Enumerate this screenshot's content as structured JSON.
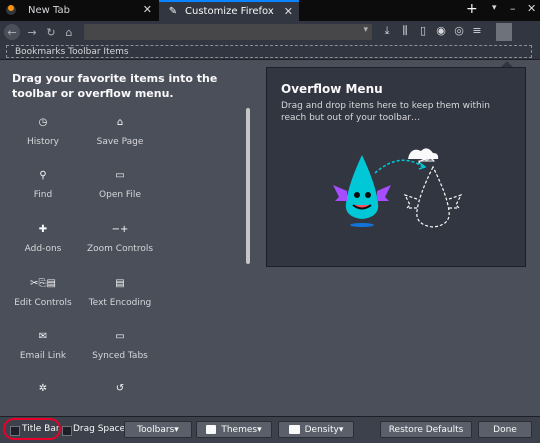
{
  "tabs": [
    {
      "label": "New Tab"
    },
    {
      "label": "Customize Firefox"
    }
  ],
  "bookmarks_toolbar": {
    "label": "Bookmarks Toolbar Items"
  },
  "palette": {
    "title": "Drag your favorite items into the toolbar or overflow menu.",
    "items": [
      {
        "label": "History",
        "icon": "clock-icon",
        "glyph": "◷"
      },
      {
        "label": "Save Page",
        "icon": "folder-icon",
        "glyph": "⌂"
      },
      {
        "label": "Find",
        "icon": "search-icon",
        "glyph": "⚲"
      },
      {
        "label": "Open File",
        "icon": "open-file-icon",
        "glyph": "▭"
      },
      {
        "label": "Add-ons",
        "icon": "puzzle-icon",
        "glyph": "✚"
      },
      {
        "label": "Zoom Controls",
        "icon": "zoom-icon",
        "glyph": "−+"
      },
      {
        "label": "Edit Controls",
        "icon": "scissors-icon",
        "glyph": "✂⎘▤"
      },
      {
        "label": "Text Encoding",
        "icon": "text-encoding-icon",
        "glyph": "▤"
      },
      {
        "label": "Email Link",
        "icon": "envelope-icon",
        "glyph": "✉"
      },
      {
        "label": "Synced Tabs",
        "icon": "laptop-icon",
        "glyph": "▭"
      },
      {
        "label": "",
        "icon": "gear-icon",
        "glyph": "✲"
      },
      {
        "label": "",
        "icon": "history-icon",
        "glyph": "↺"
      }
    ]
  },
  "overflow_menu": {
    "title": "Overflow Menu",
    "description": "Drag and drop items here to keep them within reach but out of your toolbar…"
  },
  "footer": {
    "title_bar": "Title Bar",
    "drag_space": "Drag Space",
    "toolbars": "Toolbars",
    "themes": "Themes",
    "density": "Density",
    "restore": "Restore Defaults",
    "done": "Done"
  },
  "colors": {
    "accent": "#0a84ff",
    "highlight": "#e8002a",
    "background": "#4a4f59"
  }
}
